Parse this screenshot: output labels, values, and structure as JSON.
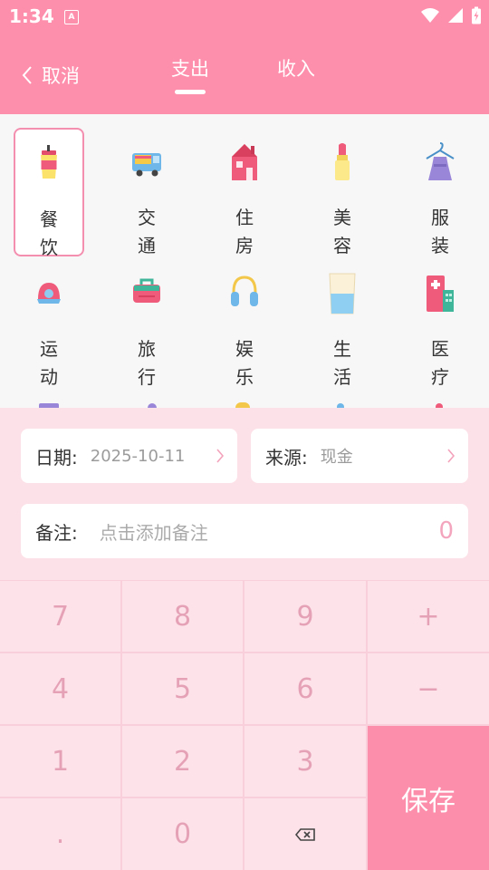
{
  "status_bar": {
    "time": "1:34",
    "notification_icon": "A"
  },
  "header": {
    "cancel_label": "取消",
    "tabs": [
      {
        "label": "支出",
        "active": true
      },
      {
        "label": "收入",
        "active": false
      }
    ]
  },
  "categories": [
    {
      "label": "餐饮",
      "icon": "drink-cup-icon",
      "selected": true
    },
    {
      "label": "交通",
      "icon": "truck-icon",
      "selected": false
    },
    {
      "label": "住房",
      "icon": "house-icon",
      "selected": false
    },
    {
      "label": "美容",
      "icon": "lipstick-icon",
      "selected": false
    },
    {
      "label": "服装",
      "icon": "dress-hanger-icon",
      "selected": false
    },
    {
      "label": "运动",
      "icon": "cap-icon",
      "selected": false
    },
    {
      "label": "旅行",
      "icon": "suitcase-icon",
      "selected": false
    },
    {
      "label": "娱乐",
      "icon": "headphones-icon",
      "selected": false
    },
    {
      "label": "生活",
      "icon": "glass-icon",
      "selected": false
    },
    {
      "label": "医疗",
      "icon": "hospital-icon",
      "selected": false
    }
  ],
  "form": {
    "date_label": "日期:",
    "date_value": "2025-10-11",
    "source_label": "来源:",
    "source_value": "现金",
    "note_label": "备注:",
    "note_placeholder": "点击添加备注",
    "amount": "0"
  },
  "keypad": {
    "keys": [
      "7",
      "8",
      "9",
      "+",
      "4",
      "5",
      "6",
      "−",
      "1",
      "2",
      "3",
      ".",
      "0"
    ],
    "backspace_icon": "backspace-icon",
    "save_label": "保存"
  },
  "colors": {
    "primary": "#fe8fac",
    "keypad_bg": "#fde2e9",
    "key_text": "#e5a2b6",
    "accent_border": "#f48fb0"
  }
}
